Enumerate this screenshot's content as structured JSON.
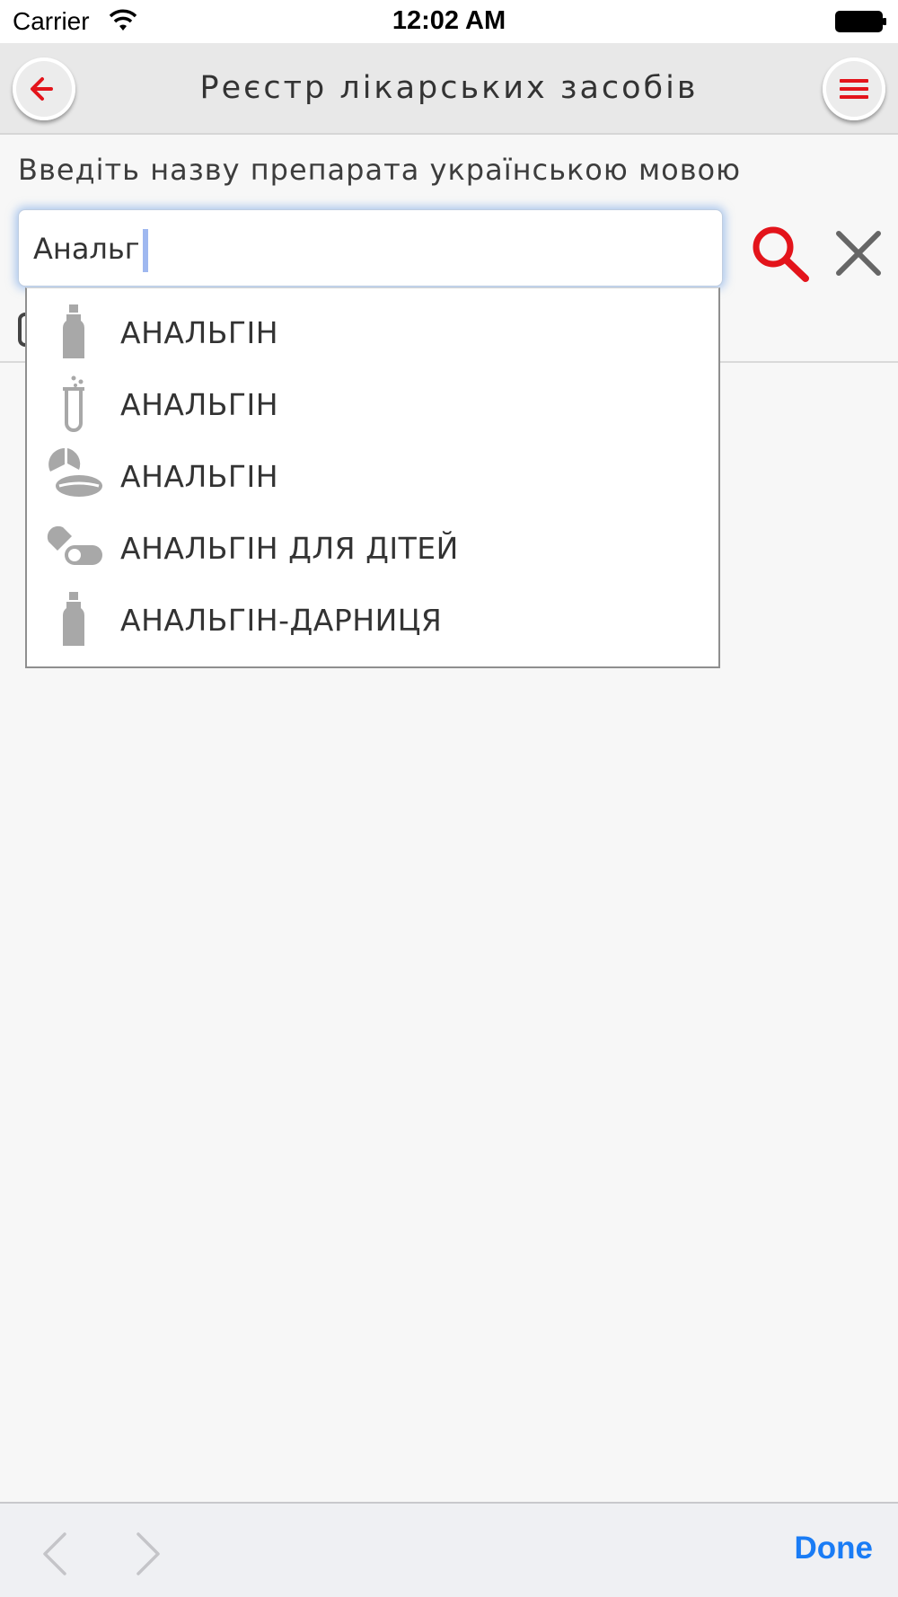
{
  "status_bar": {
    "carrier": "Carrier",
    "time": "12:02 AM"
  },
  "nav": {
    "title": "Реєстр лікарських засобів",
    "back_icon": "arrow-left-icon",
    "menu_icon": "hamburger-menu-icon"
  },
  "search": {
    "prompt": "Введіть назву препарата українською мовою",
    "value": "Анальг"
  },
  "suggestions": [
    {
      "label": "АНАЛЬГІН",
      "icon": "bottle-icon"
    },
    {
      "label": "АНАЛЬГІН",
      "icon": "test-tube-icon"
    },
    {
      "label": "АНАЛЬГІН",
      "icon": "tablet-icon"
    },
    {
      "label": "АНАЛЬГІН ДЛЯ ДІТЕЙ",
      "icon": "capsule-icon"
    },
    {
      "label": "АНАЛЬГІН-ДАРНИЦЯ",
      "icon": "bottle-icon"
    }
  ],
  "toolbar": {
    "done_label": "Done"
  },
  "colors": {
    "accent_red": "#e3141b",
    "done_blue": "#1a7cf5",
    "icon_gray": "#a8a8a8"
  }
}
